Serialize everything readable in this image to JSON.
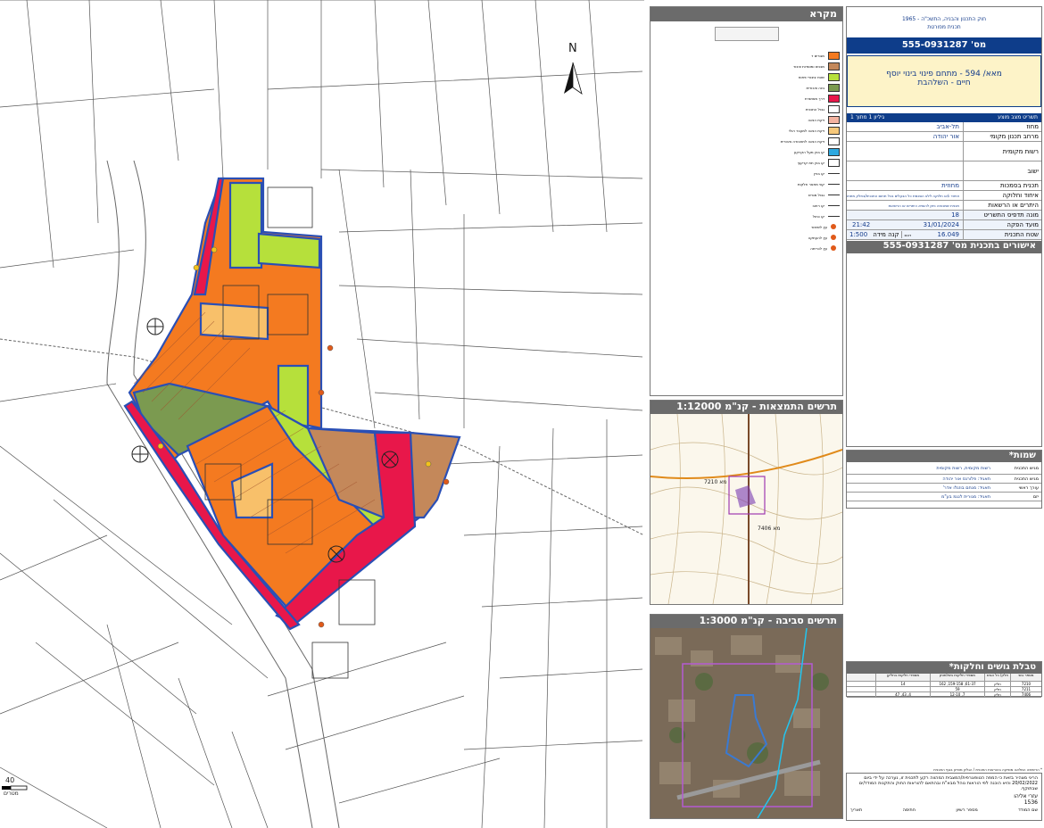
{
  "map": {
    "north_label": "N",
    "scale_value": "40",
    "scale_unit": "מטרים",
    "colors": {
      "residential": "#f47a20",
      "residential_hatched": "#f5a04a",
      "open_space": "#b6e03b",
      "park": "#7b9a50",
      "road": "#e8174a",
      "mixed": "#c4885a",
      "boundary": "#2a4fb5"
    }
  },
  "legend": {
    "title": "מקרא",
    "items": [
      {
        "label": "מגורים ד",
        "color": "#f47a20"
      },
      {
        "label": "מבנים ומוסדות ציבור",
        "color": "#c4885a"
      },
      {
        "label": "שטח ציבורי פתוח",
        "color": "#b6e03b"
      },
      {
        "label": "גינה ציבורית",
        "color": "#7b9a50"
      },
      {
        "label": "דרך מאושרת",
        "color": "#e8174a"
      },
      {
        "label": "גבול התכנית",
        "color": "#ffffff"
      },
      {
        "label": "זיקת הנאה",
        "color": "#f3b3a0"
      },
      {
        "label": "זיקת הנאה למעבר רגלי",
        "color": "#f6c87a"
      },
      {
        "label": "זיקת הנאה לתחבורה ציבורית",
        "color": "#ffffff"
      },
      {
        "label": "קו בנין מעל הקרקע",
        "color": "#2ea9e0"
      },
      {
        "label": "קו בנין תת קרקעי",
        "color": "#ffffff"
      }
    ],
    "lines": [
      "קו בניין",
      "קווי מתאר חלקות",
      "גבול מגרש",
      "קו רחוב",
      "קו כחול"
    ],
    "symbols": [
      "עץ לשימור",
      "עץ להעתקה",
      "עץ לכריתה"
    ]
  },
  "title_block": {
    "law": "חוק התכנון והבניה, התשכ\"ה - 1965",
    "plan_type": "תכנית מפורטת",
    "plan_no_label": "מס' 555-0931287",
    "plan_name_line1": "מאא/ 594 - מתחם פינוי בינוי יוסף",
    "plan_name_line2": "חיים - השלהבת",
    "sheet_left": "גיליון 1 מתוך 1",
    "sheet_right": "תשריט מצב מוצע",
    "rows": [
      {
        "label": "מחוז",
        "value": "תל-אביב"
      },
      {
        "label": "מרחב תכנון מקומי",
        "value": "אור יהודה"
      },
      {
        "label": "רשות מקומית",
        "value": ""
      },
      {
        "label": "ישוב",
        "value": ""
      },
      {
        "label": "תכנית בסמכות",
        "value": "מחוזית"
      },
      {
        "label": "איחוד וחלוקה",
        "value": "איחוד ו/או חלוקה ללא הסכמת כל הבעלים בכל תחום התכנית/בחלק מתחום התכנית"
      },
      {
        "label": "היתרים או הרשאות",
        "value": "תכנית שמכוחה ניתן להוציא היתרים או הרשאות"
      },
      {
        "label": "מונה תדפיס התשריט",
        "value": "18"
      },
      {
        "label": "מועד הפקה",
        "value": "31/01/2024",
        "extra": "21:42"
      },
      {
        "label": "שטח התכנית",
        "value": "16.049",
        "unit": "דונם",
        "scale_label": "קנה מידה",
        "scale": "1:500"
      }
    ],
    "approvals_title": "אישורים בתכנית מס' 555-0931287"
  },
  "names": {
    "title": "שמות*",
    "rows": [
      {
        "label": "מגיש התכנית",
        "value": "רשות מקומית, רשות מקומית"
      },
      {
        "label": "מגיש התכנית",
        "value": "תאגיד: פלורנס אור יהודה"
      },
      {
        "label": "עורך ראשי",
        "value": "תאגיד: מנחם בוזגלו אדר'"
      },
      {
        "label": "יזם",
        "value": "תאגיד: מגורית לנגמ בע\"מ"
      }
    ]
  },
  "orientation": {
    "title": "תרשים התמצאות - קנ\"מ 1:12000",
    "labels": [
      "7210 מא",
      "7406 מא"
    ]
  },
  "surroundings": {
    "title": "תרשים סביבה - קנ\"מ 1:3000"
  },
  "parcels": {
    "title": "טבלת גושים וחלקות*",
    "headers": [
      "מספר גוש",
      "חלק/ כל הגוש",
      "מספרי חלקות בשלמותן",
      "מספרי חלקות בחלקן"
    ],
    "rows": [
      [
        "7210",
        "חלק",
        "61-37, 159-158, 162",
        "14"
      ],
      [
        "7211",
        "חלק",
        "59",
        ""
      ],
      [
        "7406",
        "חלק",
        "7, 12-10",
        "4, 43, 47"
      ]
    ]
  },
  "footer": {
    "note": "* הרשימה המלאה מופיעה בהוראות התכנית / הגליון מופיע בגוף התכנית",
    "declaration": "הריני מצהיר בזאת כי המפה הטופוגרפית/המצבית המהווה רקע לתכנית זו, נערכה על ידי ביום 20/02/2022 והיא הוכנה לפי הוראות נוהל מבא\"ת ובהתאם להוראות החוק והתקנות המודד/ים שבתוקף.",
    "surveyor_name": "עזרי אליהו",
    "surveyor_no": "1536",
    "labels": [
      "שם המודד",
      "מספר רשיון",
      "חתימה",
      "תאריך"
    ]
  }
}
